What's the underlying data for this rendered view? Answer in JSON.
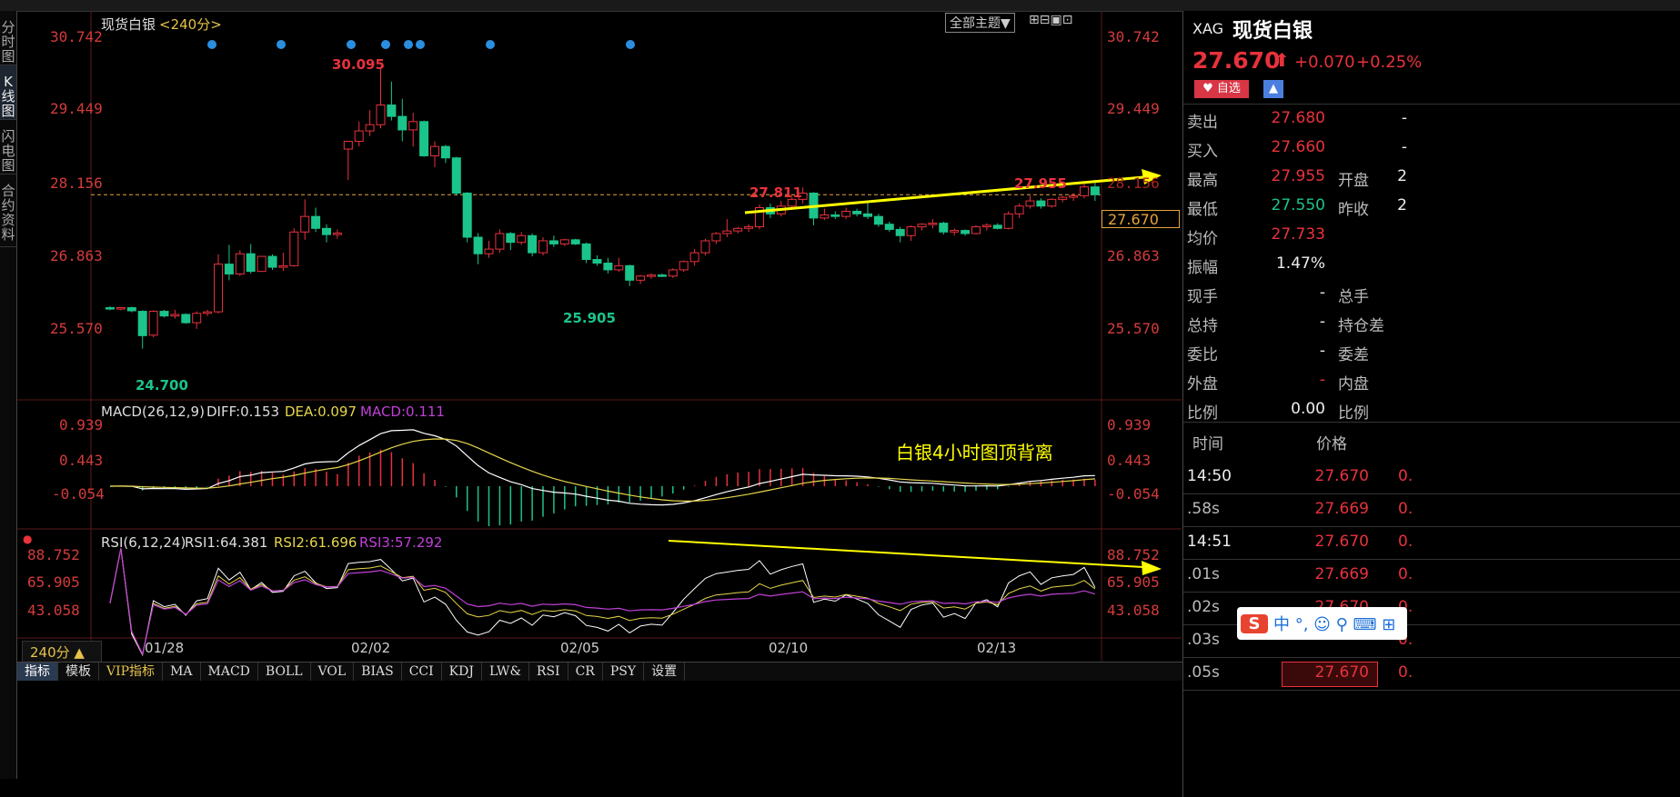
{
  "top_toolbar": {
    "visible": "partial"
  },
  "left_tabs": [
    {
      "label": "分时图",
      "active": false
    },
    {
      "label": "K线图",
      "active": true
    },
    {
      "label": "闪电图",
      "active": false
    },
    {
      "label": "合约资料",
      "active": false
    }
  ],
  "chart_header": {
    "title": "现货白银",
    "period": "<240分>",
    "theme_button": "全部主题▼"
  },
  "price_axis": {
    "ticks": [
      "30.742",
      "29.449",
      "28.156",
      "26.863",
      "25.570"
    ],
    "current_tag": "27.670"
  },
  "annotations": {
    "high": "30.095",
    "low": "24.700",
    "low2": "25.905",
    "peak1": "27.811",
    "peak2": "27.955",
    "divergence_note": "白银4小时图顶背离"
  },
  "macd": {
    "label": "MACD(26,12,9)",
    "diff": "DIFF:0.153",
    "dea": "DEA:0.097",
    "macd": "MACD:0.111",
    "ticks": [
      "0.939",
      "0.443",
      "-0.054"
    ]
  },
  "rsi": {
    "label": "RSI(6,12,24)",
    "rsi1": "RSI1:64.381",
    "rsi2": "RSI2:61.696",
    "rsi3": "RSI3:57.292",
    "ticks": [
      "88.752",
      "65.905",
      "43.058"
    ]
  },
  "date_axis": [
    "01/28",
    "02/02",
    "02/05",
    "02/10",
    "02/13"
  ],
  "period_selector": "240分 ▲",
  "bottom_tabs": [
    "指标",
    "模板",
    "VIP指标",
    "MA",
    "MACD",
    "BOLL",
    "VOL",
    "BIAS",
    "CCI",
    "KDJ",
    "LW&",
    "RSI",
    "CR",
    "PSY",
    "设置"
  ],
  "colors": {
    "up": "#e8323c",
    "down": "#1bc48a",
    "dif": "#ffffff",
    "dea": "#e6d64a",
    "macd3": "#c040d8",
    "arrow": "#ffff00",
    "bg": "#000000"
  },
  "quote": {
    "code": "XAG",
    "name": "现货白银",
    "price": "27.670",
    "arrow": "⬆",
    "change": "+0.070",
    "change_pct": "+0.25%",
    "watch_button": "自选",
    "rows": [
      {
        "l": "卖出",
        "v": "27.680",
        "l2": "",
        "v2": "-",
        "c": "red"
      },
      {
        "l": "买入",
        "v": "27.660",
        "l2": "",
        "v2": "-",
        "c": "red"
      },
      {
        "l": "最高",
        "v": "27.955",
        "l2": "开盘",
        "v2": "2",
        "c": "red"
      },
      {
        "l": "最低",
        "v": "27.550",
        "l2": "昨收",
        "v2": "2",
        "c": "green"
      },
      {
        "l": "均价",
        "v": "27.733",
        "l2": "",
        "v2": "",
        "c": "red"
      },
      {
        "l": "振幅",
        "v": "1.47%",
        "l2": "",
        "v2": "",
        "c": "white"
      },
      {
        "l": "现手",
        "v": "-",
        "l2": "总手",
        "v2": "",
        "c": "white"
      },
      {
        "l": "总持",
        "v": "-",
        "l2": "持仓差",
        "v2": "",
        "c": "white"
      },
      {
        "l": "委比",
        "v": "-",
        "l2": "委差",
        "v2": "",
        "c": "white"
      },
      {
        "l": "外盘",
        "v": "-",
        "l2": "内盘",
        "v2": "",
        "c": "red"
      },
      {
        "l": "比例",
        "v": "0.00",
        "l2": "比例",
        "v2": "",
        "c": "white"
      }
    ],
    "ticks_header": {
      "time": "时间",
      "price": "价格"
    },
    "ticks": [
      {
        "t": "14:50",
        "p": "27.670",
        "v": "0."
      },
      {
        "t": ".58s",
        "p": "27.669",
        "v": "0."
      },
      {
        "t": "14:51",
        "p": "27.670",
        "v": "0."
      },
      {
        "t": ".01s",
        "p": "27.669",
        "v": "0."
      },
      {
        "t": ".02s",
        "p": "27.670",
        "v": "0."
      },
      {
        "t": ".03s",
        "p": "",
        "v": "0."
      },
      {
        "t": ".05s",
        "p": "27.670",
        "v": "0."
      }
    ]
  },
  "ime_bar": "S 中 °, ☺ 🎤 ⌨ ⬚",
  "chart_data": {
    "type": "candlestick",
    "title": "现货白银 <240分>",
    "price_range": [
      24.7,
      30.742
    ],
    "candles": [
      {
        "o": 25.49,
        "h": 25.52,
        "l": 25.44,
        "c": 25.47
      },
      {
        "o": 25.47,
        "h": 25.5,
        "l": 25.44,
        "c": 25.49
      },
      {
        "o": 25.49,
        "h": 25.51,
        "l": 25.4,
        "c": 25.43
      },
      {
        "o": 25.42,
        "h": 25.44,
        "l": 24.7,
        "c": 24.95
      },
      {
        "o": 24.96,
        "h": 25.44,
        "l": 24.92,
        "c": 25.42
      },
      {
        "o": 25.42,
        "h": 25.45,
        "l": 25.3,
        "c": 25.33
      },
      {
        "o": 25.33,
        "h": 25.45,
        "l": 25.28,
        "c": 25.36
      },
      {
        "o": 25.36,
        "h": 25.38,
        "l": 25.18,
        "c": 25.2
      },
      {
        "o": 25.2,
        "h": 25.42,
        "l": 25.08,
        "c": 25.38
      },
      {
        "o": 25.38,
        "h": 25.45,
        "l": 25.33,
        "c": 25.41
      },
      {
        "o": 25.41,
        "h": 26.52,
        "l": 25.38,
        "c": 26.33
      },
      {
        "o": 26.33,
        "h": 26.7,
        "l": 26.02,
        "c": 26.14
      },
      {
        "o": 26.14,
        "h": 26.6,
        "l": 26.1,
        "c": 26.53
      },
      {
        "o": 26.53,
        "h": 26.72,
        "l": 26.15,
        "c": 26.19
      },
      {
        "o": 26.19,
        "h": 26.48,
        "l": 26.18,
        "c": 26.48
      },
      {
        "o": 26.48,
        "h": 26.52,
        "l": 26.22,
        "c": 26.27
      },
      {
        "o": 26.27,
        "h": 26.55,
        "l": 26.2,
        "c": 26.3
      },
      {
        "o": 26.3,
        "h": 27.02,
        "l": 26.28,
        "c": 26.95
      },
      {
        "o": 26.95,
        "h": 27.58,
        "l": 26.8,
        "c": 27.25
      },
      {
        "o": 27.25,
        "h": 27.42,
        "l": 26.95,
        "c": 27.02
      },
      {
        "o": 27.02,
        "h": 27.1,
        "l": 26.75,
        "c": 26.9
      },
      {
        "o": 26.9,
        "h": 27.0,
        "l": 26.82,
        "c": 26.93
      },
      {
        "o": 28.55,
        "h": 28.7,
        "l": 27.95,
        "c": 28.7
      },
      {
        "o": 28.7,
        "h": 29.08,
        "l": 28.6,
        "c": 28.9
      },
      {
        "o": 28.9,
        "h": 29.3,
        "l": 28.8,
        "c": 29.02
      },
      {
        "o": 29.02,
        "h": 30.095,
        "l": 28.95,
        "c": 29.4
      },
      {
        "o": 29.4,
        "h": 29.85,
        "l": 29.1,
        "c": 29.18
      },
      {
        "o": 29.18,
        "h": 29.52,
        "l": 28.7,
        "c": 28.92
      },
      {
        "o": 28.92,
        "h": 29.25,
        "l": 28.6,
        "c": 29.08
      },
      {
        "o": 29.08,
        "h": 29.1,
        "l": 28.4,
        "c": 28.42
      },
      {
        "o": 28.42,
        "h": 28.7,
        "l": 28.2,
        "c": 28.6
      },
      {
        "o": 28.6,
        "h": 28.63,
        "l": 28.28,
        "c": 28.38
      },
      {
        "o": 28.38,
        "h": 28.4,
        "l": 27.65,
        "c": 27.7
      },
      {
        "o": 27.7,
        "h": 27.72,
        "l": 26.75,
        "c": 26.85
      },
      {
        "o": 26.85,
        "h": 26.93,
        "l": 26.33,
        "c": 26.53
      },
      {
        "o": 26.53,
        "h": 26.78,
        "l": 26.45,
        "c": 26.62
      },
      {
        "o": 26.62,
        "h": 27.0,
        "l": 26.55,
        "c": 26.92
      },
      {
        "o": 26.92,
        "h": 26.95,
        "l": 26.6,
        "c": 26.75
      },
      {
        "o": 26.75,
        "h": 26.95,
        "l": 26.7,
        "c": 26.88
      },
      {
        "o": 26.88,
        "h": 26.92,
        "l": 26.48,
        "c": 26.55
      },
      {
        "o": 26.55,
        "h": 26.85,
        "l": 26.5,
        "c": 26.78
      },
      {
        "o": 26.78,
        "h": 26.88,
        "l": 26.66,
        "c": 26.72
      },
      {
        "o": 26.72,
        "h": 26.82,
        "l": 26.68,
        "c": 26.8
      },
      {
        "o": 26.8,
        "h": 26.82,
        "l": 26.7,
        "c": 26.72
      },
      {
        "o": 26.72,
        "h": 26.75,
        "l": 26.35,
        "c": 26.42
      },
      {
        "o": 26.42,
        "h": 26.5,
        "l": 26.3,
        "c": 26.35
      },
      {
        "o": 26.35,
        "h": 26.45,
        "l": 26.15,
        "c": 26.22
      },
      {
        "o": 26.22,
        "h": 26.45,
        "l": 26.18,
        "c": 26.3
      },
      {
        "o": 26.3,
        "h": 26.32,
        "l": 25.905,
        "c": 26.02
      },
      {
        "o": 26.02,
        "h": 26.12,
        "l": 25.95,
        "c": 26.1
      },
      {
        "o": 26.1,
        "h": 26.15,
        "l": 26.05,
        "c": 26.12
      },
      {
        "o": 26.12,
        "h": 26.15,
        "l": 26.08,
        "c": 26.1
      },
      {
        "o": 26.1,
        "h": 26.25,
        "l": 26.06,
        "c": 26.22
      },
      {
        "o": 26.22,
        "h": 26.4,
        "l": 26.18,
        "c": 26.38
      },
      {
        "o": 26.38,
        "h": 26.62,
        "l": 26.3,
        "c": 26.55
      },
      {
        "o": 26.55,
        "h": 26.82,
        "l": 26.5,
        "c": 26.78
      },
      {
        "o": 26.78,
        "h": 26.95,
        "l": 26.72,
        "c": 26.92
      },
      {
        "o": 26.92,
        "h": 27.2,
        "l": 26.85,
        "c": 26.97
      },
      {
        "o": 26.97,
        "h": 27.05,
        "l": 26.92,
        "c": 27.02
      },
      {
        "o": 27.02,
        "h": 27.1,
        "l": 26.95,
        "c": 27.05
      },
      {
        "o": 27.05,
        "h": 27.48,
        "l": 27.0,
        "c": 27.42
      },
      {
        "o": 27.42,
        "h": 27.5,
        "l": 27.22,
        "c": 27.3
      },
      {
        "o": 27.3,
        "h": 27.55,
        "l": 27.25,
        "c": 27.45
      },
      {
        "o": 27.45,
        "h": 27.62,
        "l": 27.4,
        "c": 27.58
      },
      {
        "o": 27.58,
        "h": 27.811,
        "l": 27.5,
        "c": 27.7
      },
      {
        "o": 27.7,
        "h": 27.72,
        "l": 27.08,
        "c": 27.22
      },
      {
        "o": 27.22,
        "h": 27.4,
        "l": 27.18,
        "c": 27.28
      },
      {
        "o": 27.28,
        "h": 27.35,
        "l": 27.2,
        "c": 27.25
      },
      {
        "o": 27.25,
        "h": 27.42,
        "l": 27.2,
        "c": 27.35
      },
      {
        "o": 27.35,
        "h": 27.4,
        "l": 27.25,
        "c": 27.3
      },
      {
        "o": 27.3,
        "h": 27.55,
        "l": 27.2,
        "c": 27.25
      },
      {
        "o": 27.25,
        "h": 27.3,
        "l": 27.05,
        "c": 27.1
      },
      {
        "o": 27.1,
        "h": 27.15,
        "l": 26.95,
        "c": 27.0
      },
      {
        "o": 27.0,
        "h": 27.05,
        "l": 26.75,
        "c": 26.88
      },
      {
        "o": 26.88,
        "h": 27.08,
        "l": 26.78,
        "c": 27.05
      },
      {
        "o": 27.05,
        "h": 27.12,
        "l": 26.98,
        "c": 27.1
      },
      {
        "o": 27.1,
        "h": 27.2,
        "l": 27.02,
        "c": 27.12
      },
      {
        "o": 27.12,
        "h": 27.15,
        "l": 26.9,
        "c": 26.95
      },
      {
        "o": 26.95,
        "h": 27.02,
        "l": 26.88,
        "c": 26.98
      },
      {
        "o": 26.98,
        "h": 27.0,
        "l": 26.88,
        "c": 26.92
      },
      {
        "o": 26.92,
        "h": 27.08,
        "l": 26.9,
        "c": 27.05
      },
      {
        "o": 27.05,
        "h": 27.12,
        "l": 26.98,
        "c": 27.08
      },
      {
        "o": 27.08,
        "h": 27.12,
        "l": 27.0,
        "c": 27.02
      },
      {
        "o": 27.02,
        "h": 27.35,
        "l": 27.0,
        "c": 27.3
      },
      {
        "o": 27.3,
        "h": 27.5,
        "l": 27.22,
        "c": 27.45
      },
      {
        "o": 27.45,
        "h": 27.65,
        "l": 27.4,
        "c": 27.55
      },
      {
        "o": 27.55,
        "h": 27.6,
        "l": 27.4,
        "c": 27.45
      },
      {
        "o": 27.45,
        "h": 27.6,
        "l": 27.42,
        "c": 27.58
      },
      {
        "o": 27.58,
        "h": 27.65,
        "l": 27.52,
        "c": 27.62
      },
      {
        "o": 27.62,
        "h": 27.7,
        "l": 27.55,
        "c": 27.65
      },
      {
        "o": 27.65,
        "h": 27.9,
        "l": 27.6,
        "c": 27.82
      },
      {
        "o": 27.82,
        "h": 27.955,
        "l": 27.55,
        "c": 27.67
      }
    ],
    "current_price": 27.67,
    "macd": {
      "diff": 0.153,
      "dea": 0.097,
      "macd": 0.111,
      "range": [
        -0.054,
        0.939
      ]
    },
    "rsi": {
      "rsi1": 64.381,
      "rsi2": 61.696,
      "rsi3": 57.292,
      "range": [
        43.058,
        88.752
      ]
    },
    "x_labels": [
      "01/28",
      "02/02",
      "02/05",
      "02/10",
      "02/13"
    ]
  }
}
